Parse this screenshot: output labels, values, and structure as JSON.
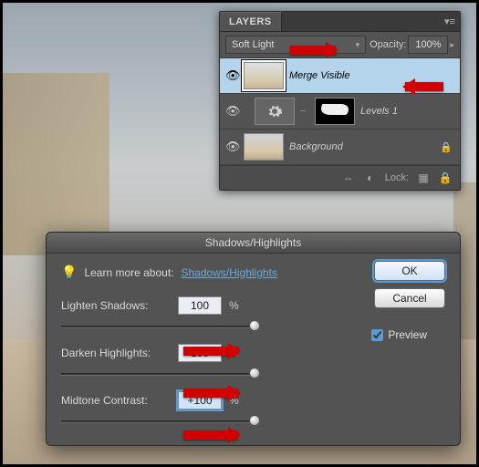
{
  "layers": {
    "tab_label": "LAYERS",
    "blend_mode": "Soft Light",
    "opacity_label": "Opacity:",
    "opacity_value": "100%",
    "items": [
      {
        "name": "Merge Visible",
        "visible": true,
        "selected": true,
        "type": "image"
      },
      {
        "name": "Levels 1",
        "visible": true,
        "selected": false,
        "type": "adjustment"
      },
      {
        "name": "Background",
        "visible": true,
        "selected": false,
        "type": "image",
        "locked": true
      }
    ],
    "footer": {
      "lock_label": "Lock:"
    }
  },
  "dialog": {
    "title": "Shadows/Highlights",
    "learn_prefix": "Learn more about:",
    "learn_link": "Shadows/Highlights",
    "sliders": [
      {
        "label": "Lighten Shadows:",
        "value": "100",
        "unit": "%",
        "pos": 100
      },
      {
        "label": "Darken Highlights:",
        "value": "100",
        "unit": "%",
        "pos": 100
      },
      {
        "label": "Midtone Contrast:",
        "value": "+100",
        "unit": "%",
        "pos": 100,
        "active": true
      }
    ],
    "ok": "OK",
    "cancel": "Cancel",
    "preview": "Preview"
  }
}
